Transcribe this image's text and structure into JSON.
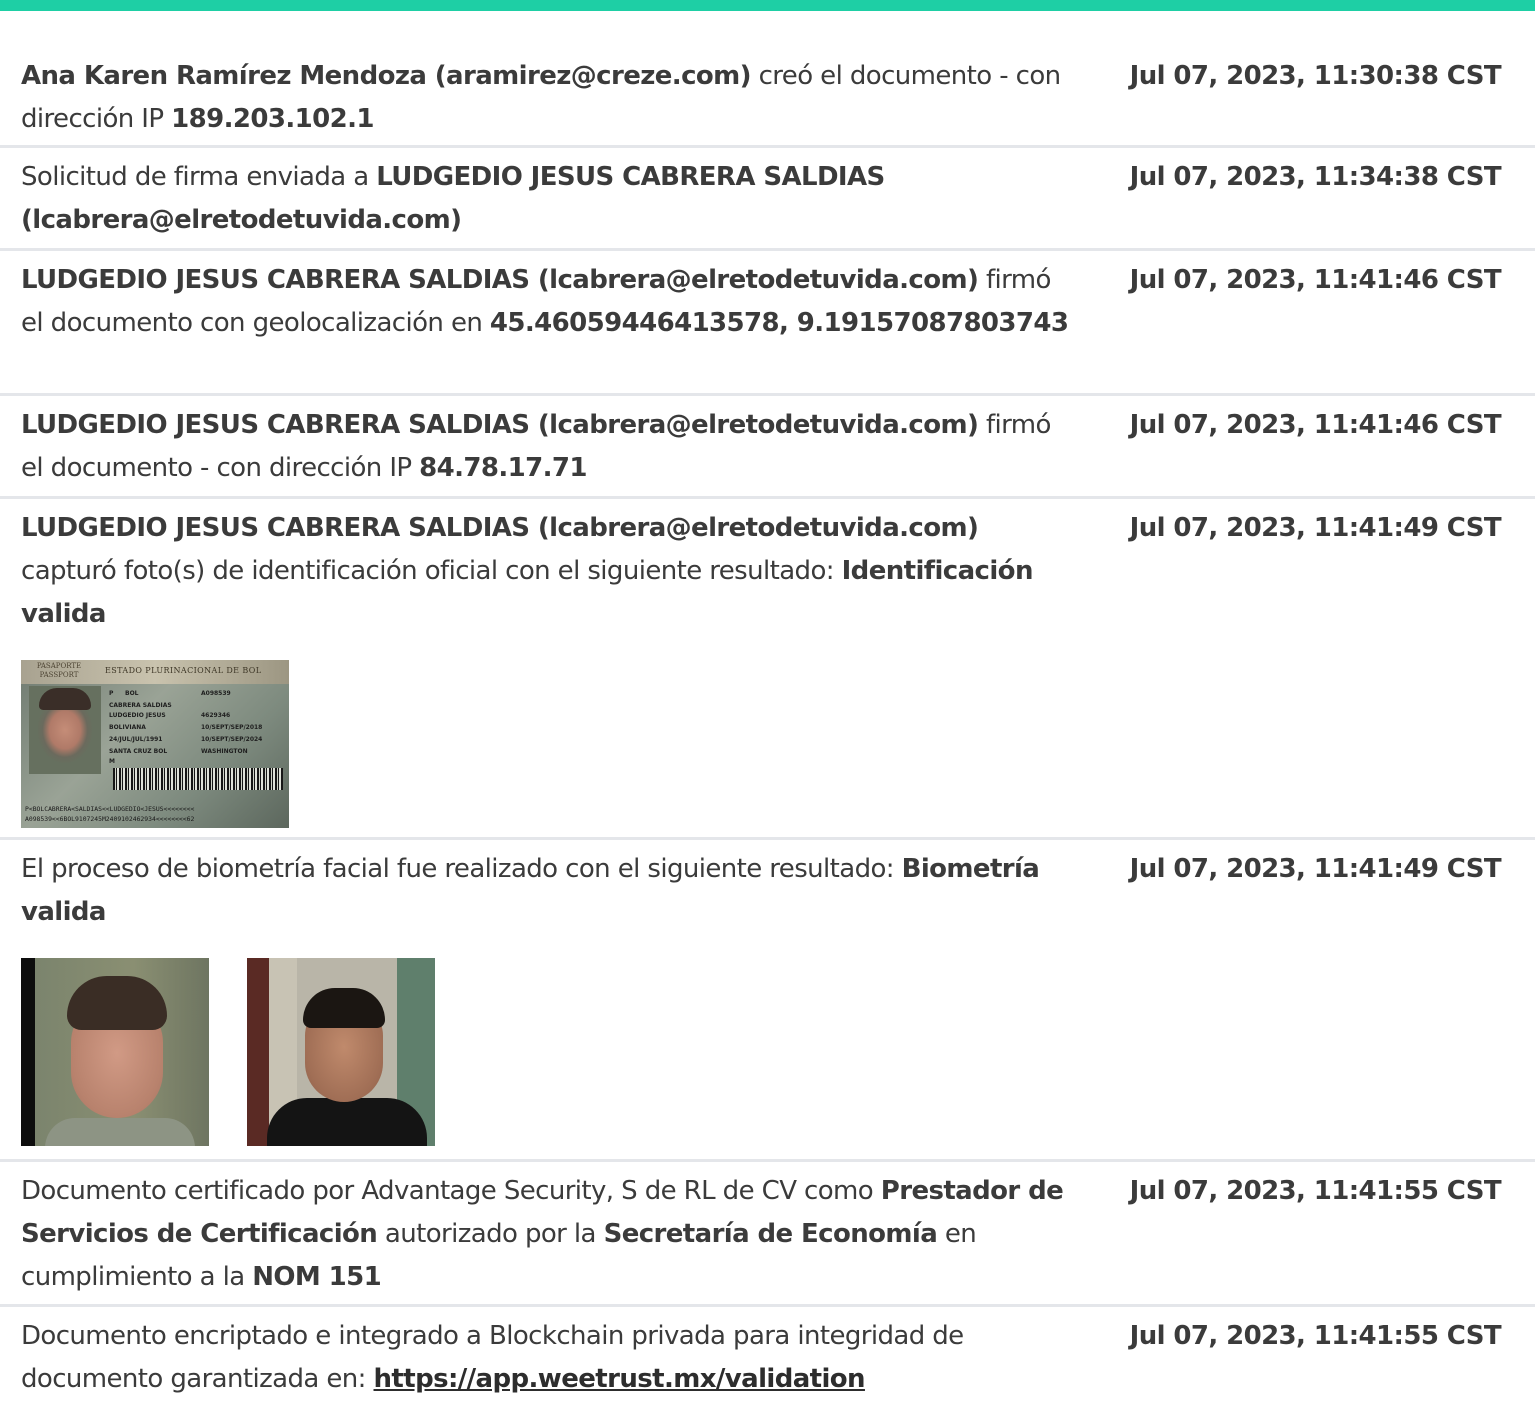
{
  "entries": [
    {
      "parts": [
        {
          "t": "Ana Karen Ramírez Mendoza (aramirez@creze.com)",
          "b": true
        },
        {
          "t": " creó el documento - con dirección IP ",
          "b": false
        },
        {
          "t": "189.203.102.1",
          "b": true
        }
      ],
      "date": "Jul 07, 2023, 11:30:38 CST"
    },
    {
      "parts": [
        {
          "t": "Solicitud de firma enviada a ",
          "b": false
        },
        {
          "t": "LUDGEDIO JESUS CABRERA SALDIAS (lcabrera@elretodetuvida.com)",
          "b": true
        }
      ],
      "date": "Jul 07, 2023, 11:34:38 CST"
    },
    {
      "parts": [
        {
          "t": "LUDGEDIO JESUS CABRERA SALDIAS (lcabrera@elretodetuvida.com)",
          "b": true
        },
        {
          "t": " firmó el documento con geolocalización en ",
          "b": false
        },
        {
          "t": "45.46059446413578, 9.19157087803743",
          "b": true
        }
      ],
      "date": "Jul 07, 2023, 11:41:46 CST"
    },
    {
      "parts": [
        {
          "t": "LUDGEDIO JESUS CABRERA SALDIAS (lcabrera@elretodetuvida.com)",
          "b": true
        },
        {
          "t": " firmó el documento - con dirección IP ",
          "b": false
        },
        {
          "t": "84.78.17.71",
          "b": true
        }
      ],
      "date": "Jul 07, 2023, 11:41:46 CST"
    },
    {
      "parts": [
        {
          "t": "LUDGEDIO JESUS CABRERA SALDIAS (lcabrera@elretodetuvida.com)",
          "b": true
        },
        {
          "t": " capturó foto(s) de identificación oficial con el siguiente resultado: ",
          "b": false
        },
        {
          "t": "Identificación valida",
          "b": true
        }
      ],
      "date": "Jul 07, 2023, 11:41:49 CST"
    },
    {
      "parts": [
        {
          "t": "El proceso de biometría facial fue realizado con el siguiente resultado: ",
          "b": false
        },
        {
          "t": "Biometría valida",
          "b": true
        }
      ],
      "date": "Jul 07, 2023, 11:41:49 CST"
    },
    {
      "parts": [
        {
          "t": "Documento certificado por Advantage Security, S de RL de CV como ",
          "b": false
        },
        {
          "t": "Prestador de Servicios de Certificación",
          "b": true
        },
        {
          "t": " autorizado por la ",
          "b": false
        },
        {
          "t": "Secretaría de Economía",
          "b": true
        },
        {
          "t": " en cumplimiento a la ",
          "b": false
        },
        {
          "t": "NOM 151",
          "b": true
        }
      ],
      "date": "Jul 07, 2023, 11:41:55 CST"
    },
    {
      "parts": [
        {
          "t": "Documento encriptado e integrado a Blockchain privada para integridad de documento garantizada en: ",
          "b": false
        }
      ],
      "link": "https://app.weetrust.mx/validation",
      "date": "Jul 07, 2023, 11:41:55 CST"
    }
  ],
  "passport": {
    "label_es": "PASAPORTE",
    "label_en": "PASSPORT",
    "state": "ESTADO PLURINACIONAL DE BOL",
    "type": "P",
    "code": "BOL",
    "number": "A098539",
    "surnames": "CABRERA SALDIAS",
    "names": "LUDGEDIO JESUS",
    "nationality": "BOLIVIANA",
    "birth": "24/JUL/JUL/1991",
    "place": "SANTA CRUZ BOL",
    "sex": "M",
    "id": "4629346",
    "issue": "10/SEPT/SEP/2018",
    "expiry": "10/SEPT/SEP/2024",
    "authority": "WASHINGTON",
    "mrz1": "P<BOLCABRERA<SALDIAS<<LUDGEDIO<JESUS<<<<<<<<",
    "mrz2": "A098539<<6BOL9107245M2409102462934<<<<<<<<62"
  }
}
